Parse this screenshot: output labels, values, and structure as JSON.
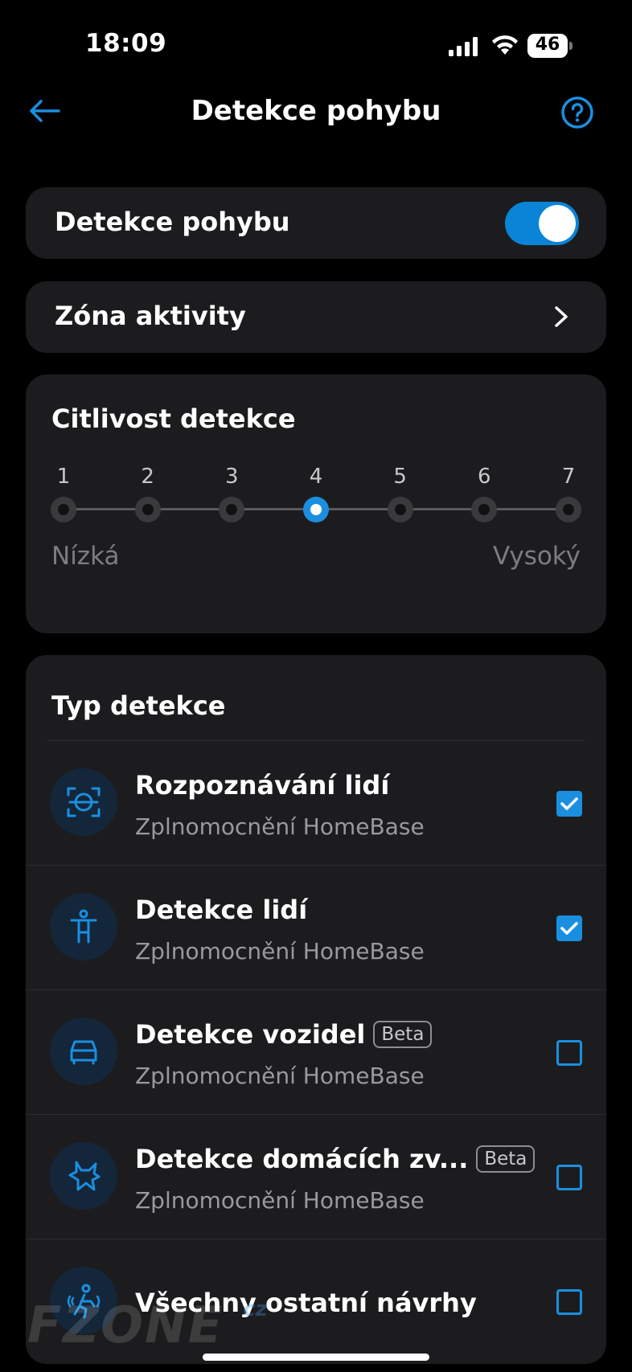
{
  "status_bar": {
    "time": "18:09",
    "battery": "46"
  },
  "header": {
    "title": "Detekce pohybu"
  },
  "motion_detection": {
    "label": "Detekce pohybu",
    "enabled": true
  },
  "activity_zone": {
    "label": "Zóna aktivity"
  },
  "sensitivity": {
    "title": "Citlivost detekce",
    "levels": [
      "1",
      "2",
      "3",
      "4",
      "5",
      "6",
      "7"
    ],
    "selected": 4,
    "low_label": "Nízká",
    "high_label": "Vysoký"
  },
  "detection_types": {
    "title": "Typ detekce",
    "items": [
      {
        "title": "Rozpoznávání lidí",
        "subtitle": "Zplnomocnění HomeBase",
        "checked": true,
        "icon": "face-recognition-icon"
      },
      {
        "title": "Detekce lidí",
        "subtitle": "Zplnomocnění HomeBase",
        "checked": true,
        "icon": "person-icon"
      },
      {
        "title": "Detekce vozidel",
        "badge": "Beta",
        "subtitle": "Zplnomocnění HomeBase",
        "checked": false,
        "icon": "car-icon"
      },
      {
        "title": "Detekce domácích zv...",
        "badge": "Beta",
        "subtitle": "Zplnomocnění HomeBase",
        "checked": false,
        "icon": "pet-icon"
      },
      {
        "title": "Všechny ostatní návrhy",
        "checked": false,
        "icon": "motion-icon"
      }
    ]
  },
  "watermark": {
    "text": "FZONE",
    "suffix": "cz"
  },
  "colors": {
    "accent": "#1a8fe0",
    "card": "#1c1c1e",
    "background": "#000000"
  }
}
